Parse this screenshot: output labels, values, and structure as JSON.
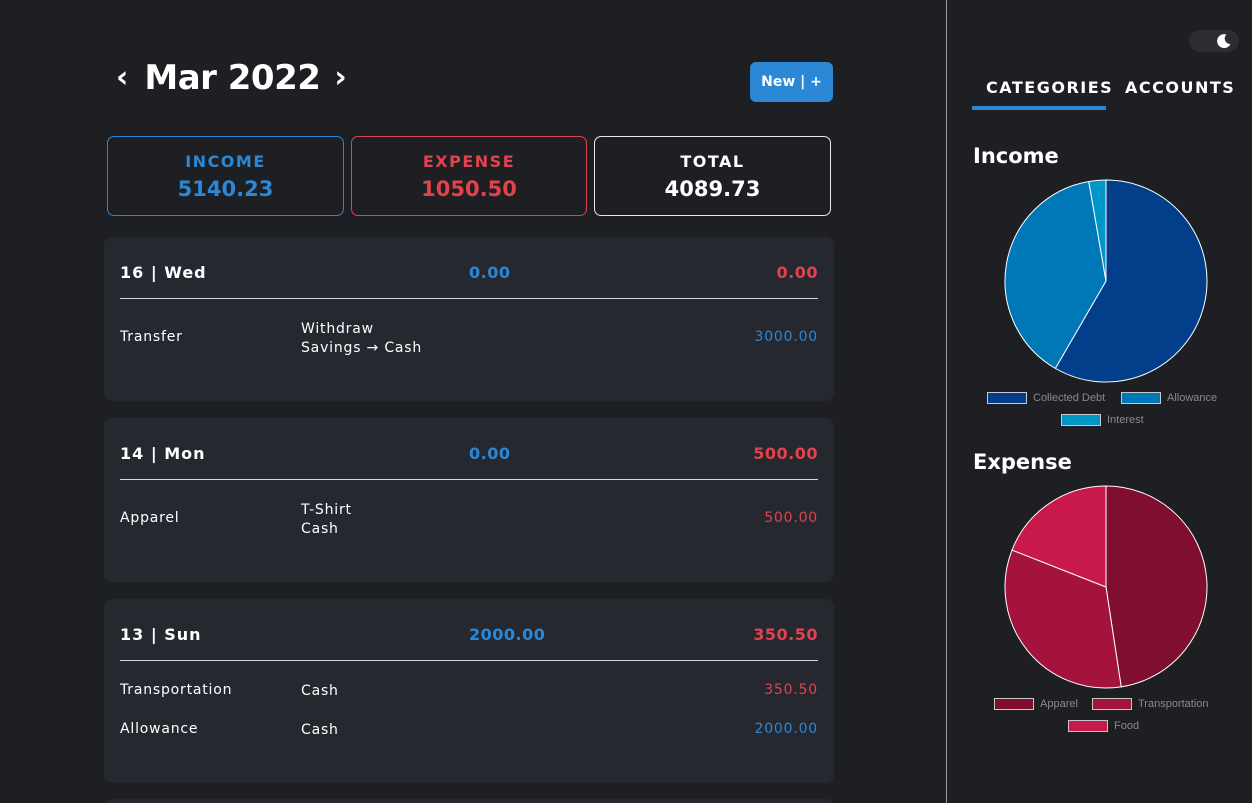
{
  "header": {
    "month": "Mar 2022",
    "prev_icon": "chevron-left-icon",
    "next_icon": "chevron-right-icon",
    "new_button": "New | +"
  },
  "summary": {
    "income_label": "INCOME",
    "income_value": "5140.23",
    "expense_label": "EXPENSE",
    "expense_value": "1050.50",
    "total_label": "TOTAL",
    "total_value": "4089.73"
  },
  "days": [
    {
      "date": "16 | Wed",
      "income": "0.00",
      "expense": "0.00",
      "transactions": [
        {
          "category": "Transfer",
          "note_line1": "Withdraw",
          "note_line2": "Savings → Cash",
          "amount": "3000.00",
          "type": "income"
        }
      ]
    },
    {
      "date": "14 | Mon",
      "income": "0.00",
      "expense": "500.00",
      "transactions": [
        {
          "category": "Apparel",
          "note_line1": "T-Shirt",
          "note_line2": "Cash",
          "amount": "500.00",
          "type": "expense"
        }
      ]
    },
    {
      "date": "13 | Sun",
      "income": "2000.00",
      "expense": "350.50",
      "transactions": [
        {
          "category": "Transportation",
          "note_line1": "Cash",
          "amount": "350.50",
          "type": "expense"
        },
        {
          "category": "Allowance",
          "note_line1": "Cash",
          "amount": "2000.00",
          "type": "income"
        }
      ]
    }
  ],
  "sidebar": {
    "theme_icon": "moon-icon",
    "tabs": [
      {
        "label": "CATEGORIES",
        "active": true
      },
      {
        "label": "ACCOUNTS",
        "active": false
      }
    ]
  },
  "colors": {
    "income": "#2a88d6",
    "expense": "#e2424d",
    "background": "#1e1f23",
    "card": "#262830"
  },
  "chart_data": [
    {
      "type": "pie",
      "title": "Income",
      "categories": [
        "Collected Debt",
        "Allowance",
        "Interest"
      ],
      "values": [
        3000,
        2000,
        140.23
      ],
      "colors": [
        "#023e8a",
        "#0077b6",
        "#0096c7"
      ]
    },
    {
      "type": "pie",
      "title": "Expense",
      "categories": [
        "Apparel",
        "Transportation",
        "Food"
      ],
      "values": [
        500,
        350.5,
        200
      ],
      "colors": [
        "#800f2f",
        "#a4133c",
        "#c9184a"
      ]
    }
  ]
}
